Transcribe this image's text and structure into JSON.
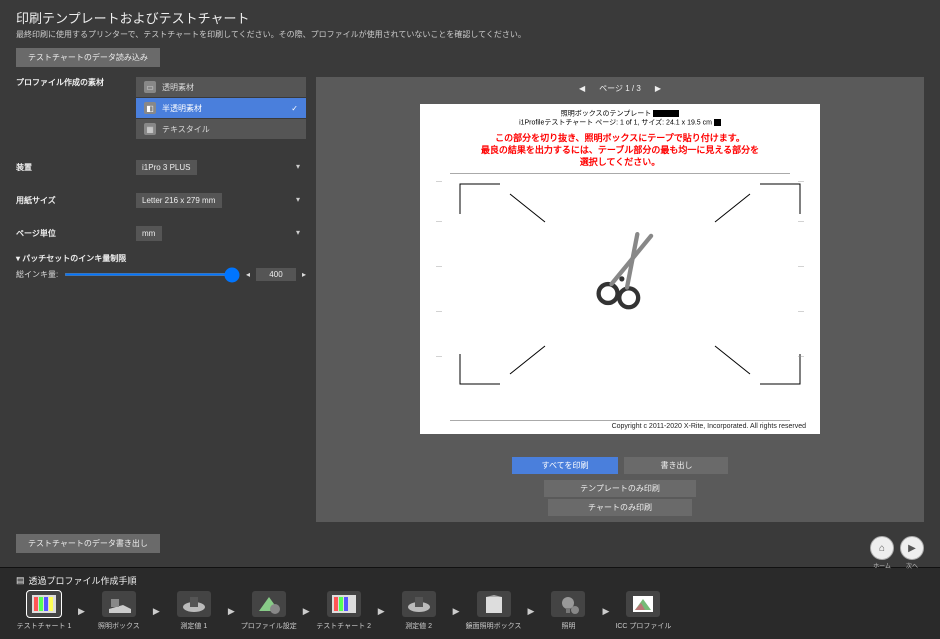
{
  "header": {
    "title": "印刷テンプレートおよびテストチャート",
    "subtitle": "最終印刷に使用するプリンターで、テストチャートを印刷してください。その際、プロファイルが使用されていないことを確認してください。"
  },
  "toolbar": {
    "read_data": "テストチャートのデータ読み込み"
  },
  "form": {
    "substrate_label": "プロファイル作成の素材",
    "substrates": [
      "透明素材",
      "半透明素材",
      "テキスタイル"
    ],
    "device_label": "装置",
    "device_value": "i1Pro 3 PLUS",
    "paper_label": "用紙サイズ",
    "paper_value": "Letter 216 x 279 mm",
    "unit_label": "ページ単位",
    "unit_value": "mm",
    "ink_section": "パッチセットのインキ量制限",
    "ink_total_label": "総インキ量:",
    "ink_total_value": "400"
  },
  "bottom_toolbar": {
    "write_data": "テストチャートのデータ書き出し"
  },
  "pager": {
    "page_text": "ページ 1 / 3"
  },
  "page": {
    "template_title": "照明ボックスのテンプレート",
    "info": "i1Profileテストチャート ページ: 1 of 1, サイズ: 24.1 x 19.5 cm",
    "red1": "この部分を切り抜き、照明ボックスにテープで貼り付けます。",
    "red2": "最良の結果を出力するには、テーブル部分の最も均一に見える部分を",
    "red3": "選択してください。",
    "copyright": "Copyright c 2011-2020 X-Rite, Incorporated. All rights reserved"
  },
  "actions": {
    "print_all": "すべてを印刷",
    "export": "書き出し",
    "print_template": "テンプレートのみ印刷",
    "print_chart": "チャートのみ印刷"
  },
  "nav": {
    "home": "ホーム",
    "next": "次へ"
  },
  "footer": {
    "title": "透過プロファイル作成手順",
    "steps": [
      "テストチャート 1",
      "照明ボックス",
      "測定値 1",
      "プロファイル設定",
      "テストチャート 2",
      "測定値 2",
      "鏡面照明ボックス",
      "照明",
      "ICC プロファイル"
    ]
  }
}
